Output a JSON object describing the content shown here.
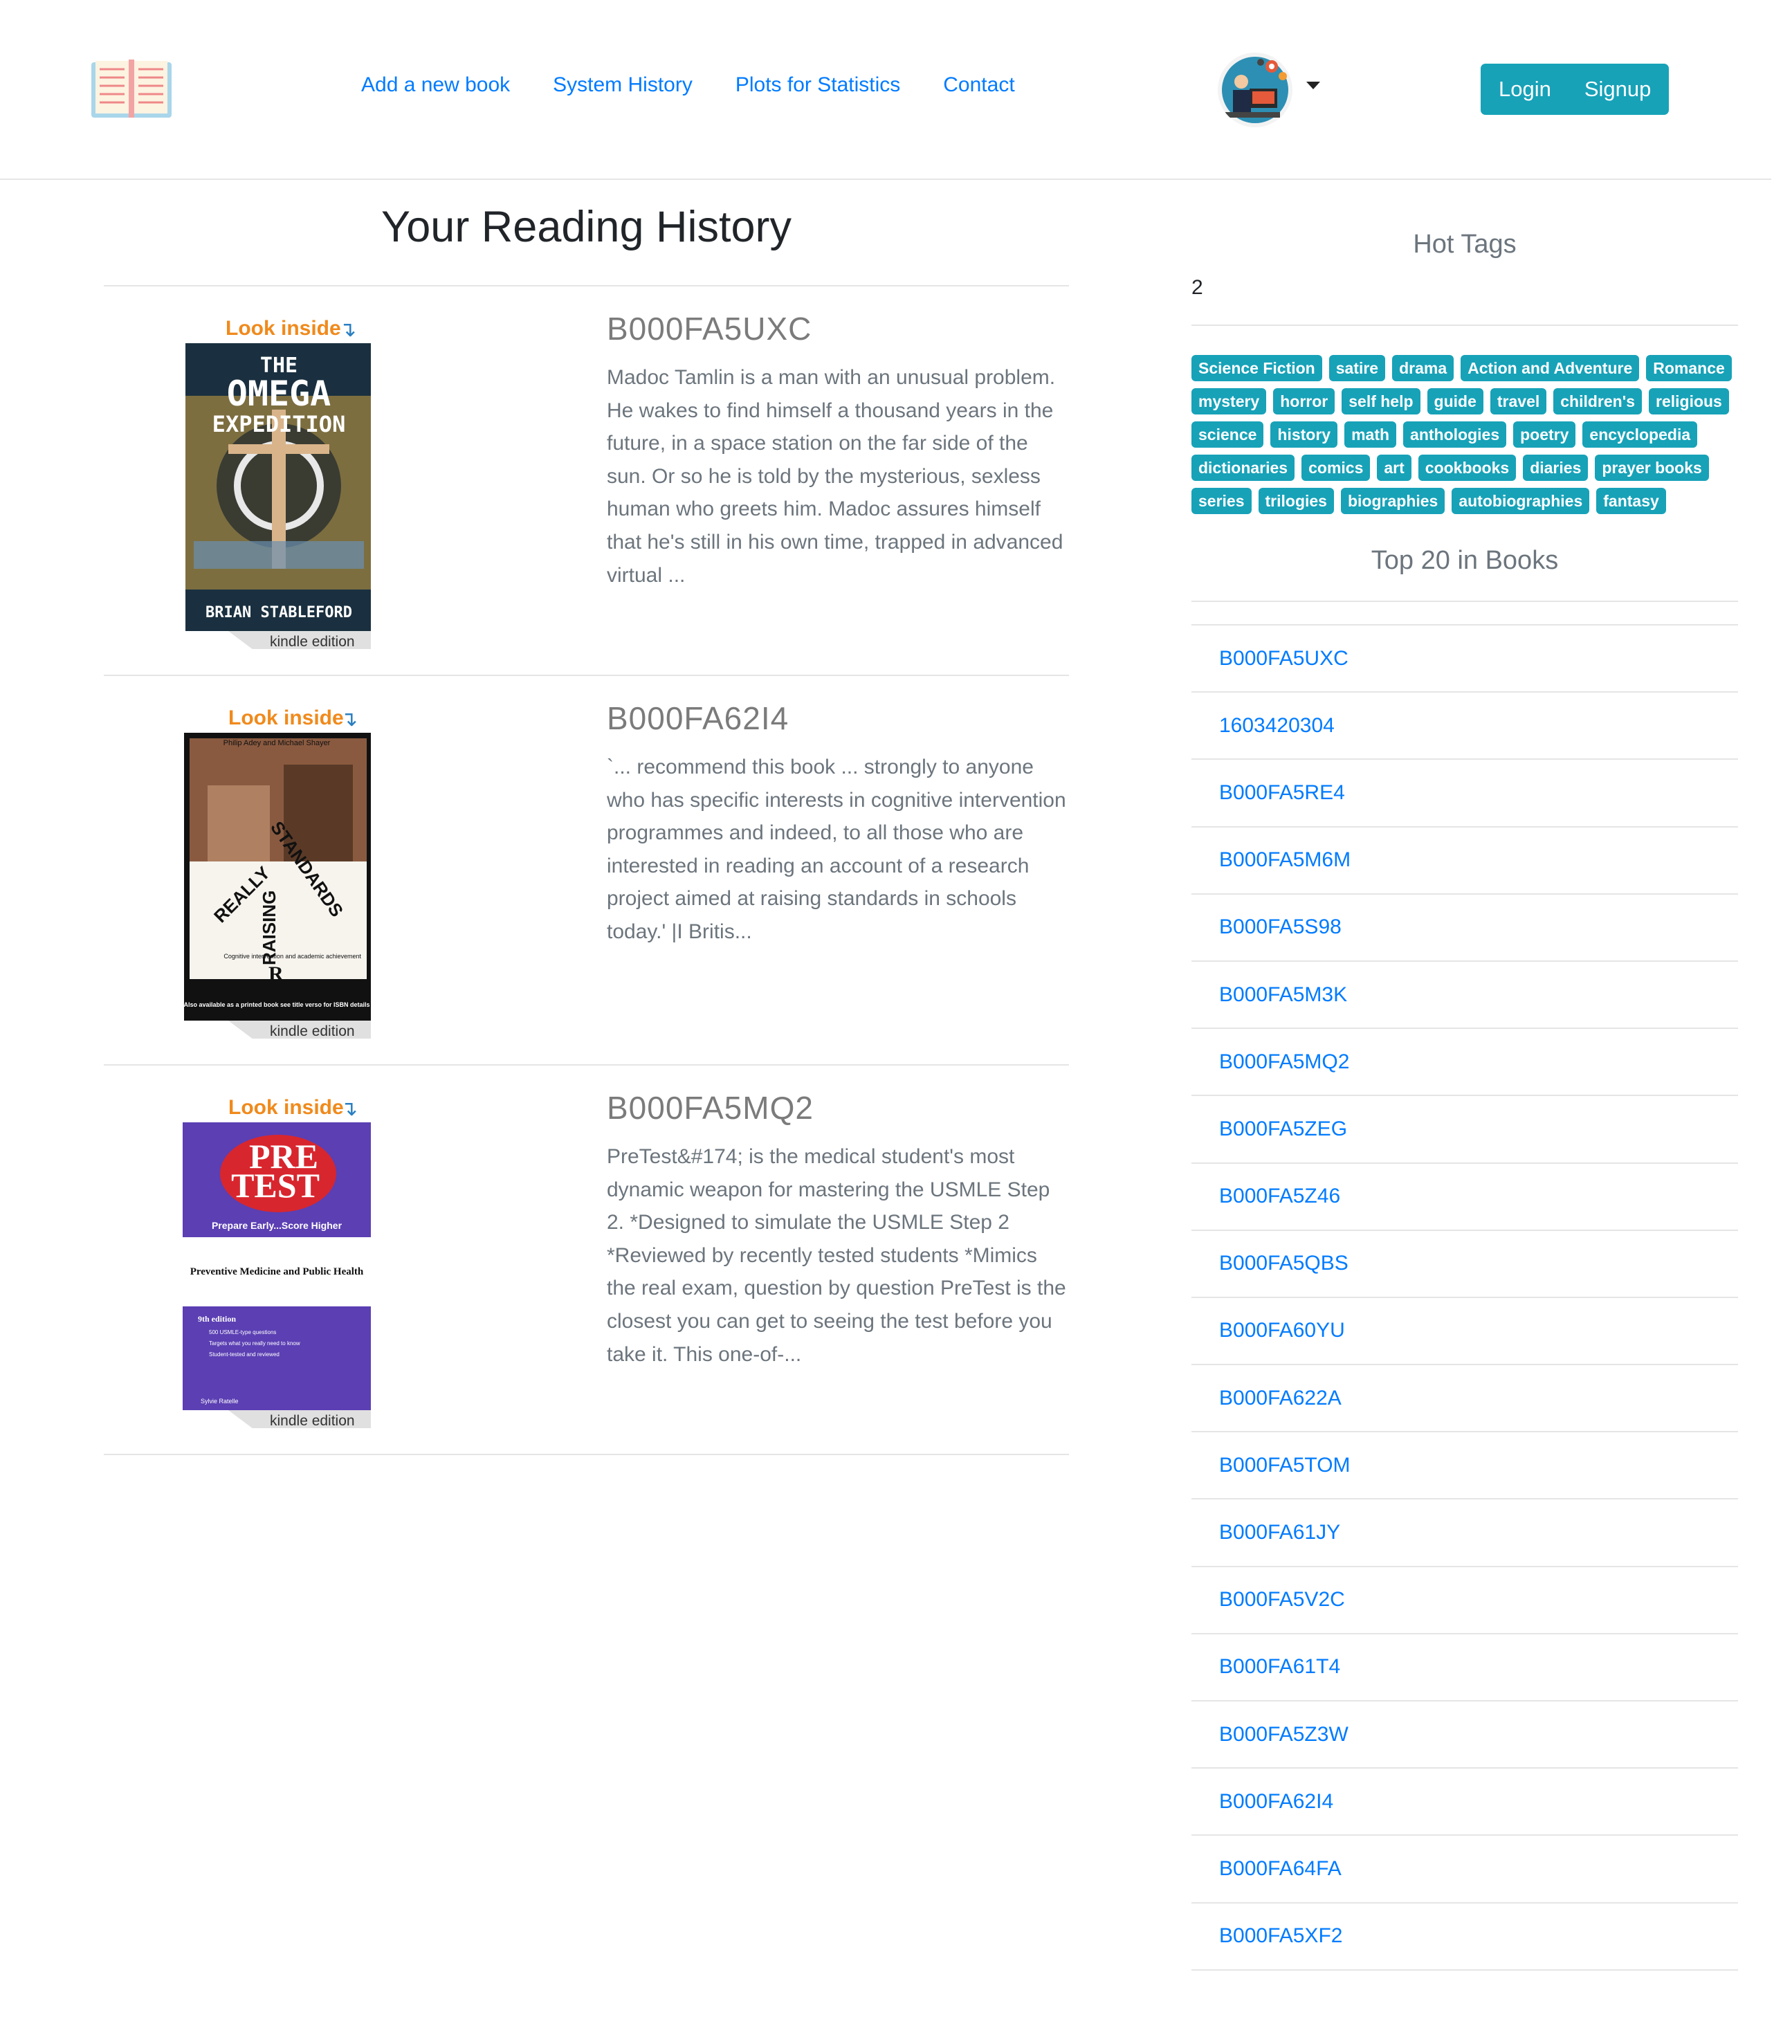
{
  "nav": {
    "links": [
      "Add a new book",
      "System History",
      "Plots for Statistics",
      "Contact"
    ],
    "login_label": "Login",
    "signup_label": "Signup"
  },
  "main": {
    "title": "Your Reading History",
    "books": [
      {
        "id": "B000FA5UXC",
        "description": "Madoc Tamlin is a man with an unusual problem. He wakes to find himself a thousand years in the future, in a space station on the far side of the sun. Or so he is told by the mysterious, sexless human who greets him. Madoc assures himself that he's still in his own time, trapped in advanced virtual ...",
        "cover": {
          "look_inside": "Look inside",
          "title_top": "THE",
          "title_main": "OMEGA",
          "title_sub": "EXPEDITION",
          "author": "BRIAN STABLEFORD",
          "badge": "kindle edition"
        }
      },
      {
        "id": "B000FA62I4",
        "description": "`... recommend this book ... strongly to anyone who has specific interests in cognitive intervention programmes and indeed, to all those who are interested in reading an account of a research project aimed at raising standards in schools today.' |I Britis...",
        "cover": {
          "look_inside": "Look inside",
          "authors": "Philip Adey and Michael Shayer",
          "title_a": "REALLY",
          "title_b": "RAISING",
          "title_c": "STANDARDS",
          "subtitle": "Cognitive intervention and academic achievement",
          "footer": "Also available as a printed book see title verso for ISBN details",
          "badge": "kindle edition"
        }
      },
      {
        "id": "B000FA5MQ2",
        "description": "PreTest&#174; is the medical student's most dynamic weapon for mastering the USMLE Step 2. *Designed to simulate the USMLE Step 2 *Reviewed by recently tested students *Mimics the real exam, question by question PreTest is the closest you can get to seeing the test before you take it. This one-of-...",
        "cover": {
          "look_inside": "Look inside",
          "title_a": "PRE",
          "title_b": "TEST",
          "tagline": "Prepare Early...Score Higher",
          "subject": "Preventive Medicine and Public Health",
          "edition": "9th edition",
          "bullets": [
            "500 USMLE-type questions",
            "Targets what you really need to know",
            "Student-tested and reviewed"
          ],
          "author": "Sylvie Ratelle",
          "badge": "kindle edition"
        }
      }
    ]
  },
  "sidebar": {
    "hot_tags_heading": "Hot Tags",
    "hot_tags_count": "2",
    "tags": [
      "Science Fiction",
      "satire",
      "drama",
      "Action and Adventure",
      "Romance",
      "mystery",
      "horror",
      "self help",
      "guide",
      "travel",
      "children's",
      "religious",
      "science",
      "history",
      "math",
      "anthologies",
      "poetry",
      "encyclopedia",
      "dictionaries",
      "comics",
      "art",
      "cookbooks",
      "diaries",
      "prayer books",
      "series",
      "trilogies",
      "biographies",
      "autobiographies",
      "fantasy"
    ],
    "top_heading": "Top 20 in Books",
    "top_books": [
      "B000FA5UXC",
      "1603420304",
      "B000FA5RE4",
      "B000FA5M6M",
      "B000FA5S98",
      "B000FA5M3K",
      "B000FA5MQ2",
      "B000FA5ZEG",
      "B000FA5Z46",
      "B000FA5QBS",
      "B000FA60YU",
      "B000FA622A",
      "B000FA5TOM",
      "B000FA61JY",
      "B000FA5V2C",
      "B000FA61T4",
      "B000FA5Z3W",
      "B000FA62I4",
      "B000FA64FA",
      "B000FA5XF2"
    ]
  },
  "colors": {
    "link": "#007bff",
    "accent": "#17a2b8",
    "muted": "#6c757d"
  }
}
